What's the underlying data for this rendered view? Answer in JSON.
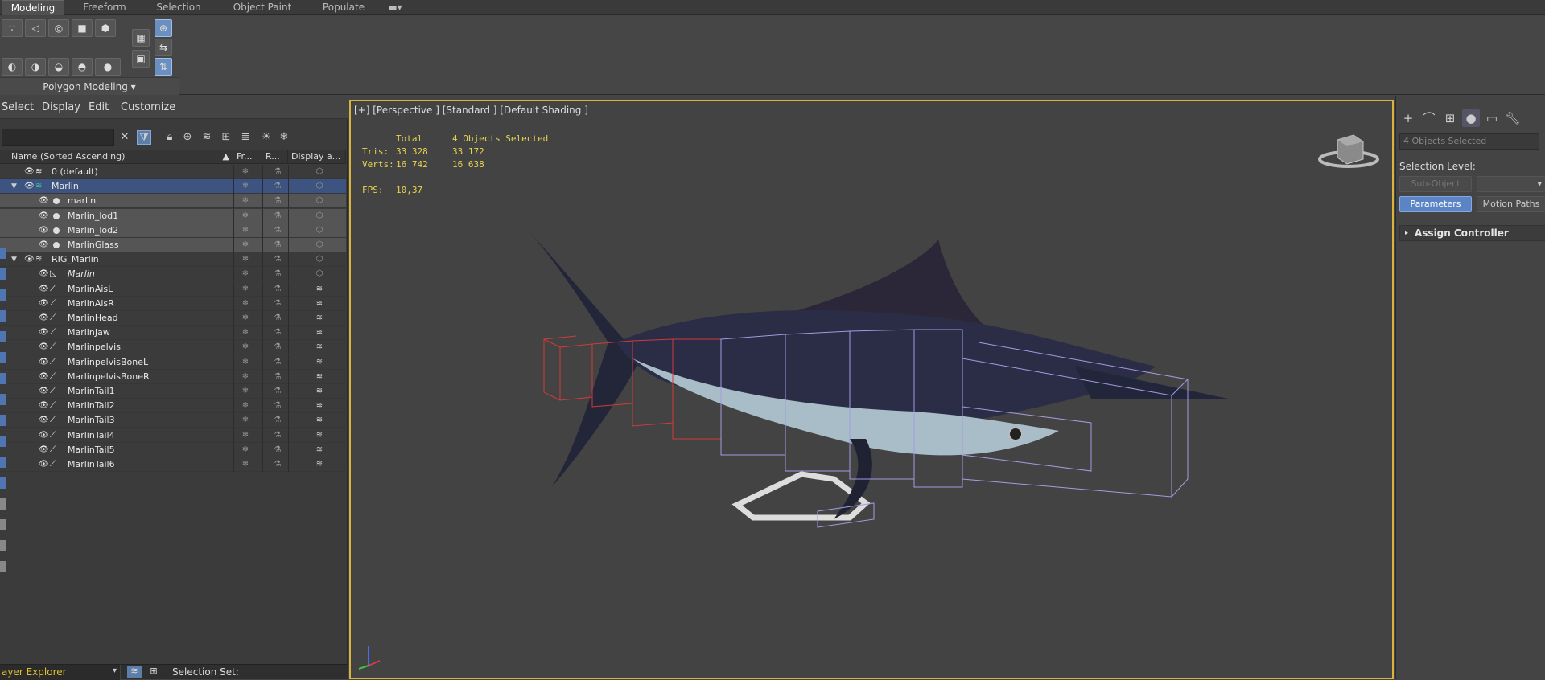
{
  "ribbon": {
    "tabs": [
      "Modeling",
      "Freeform",
      "Selection",
      "Object Paint",
      "Populate"
    ],
    "active_tab": "Modeling",
    "panel_label": "Polygon Modeling"
  },
  "explorer": {
    "menu": [
      "Select",
      "Display",
      "Edit",
      "Customize"
    ],
    "columns": {
      "name": "Name (Sorted Ascending)",
      "sort_marker": "▲",
      "frozen": "Fr...",
      "render": "R...",
      "display": "Display a..."
    },
    "rows": [
      {
        "label": "0 (default)",
        "indent": 0,
        "kind": "layer"
      },
      {
        "label": "Marlin",
        "indent": 0,
        "kind": "layer-open"
      },
      {
        "label": "marlin",
        "indent": 1,
        "kind": "object"
      },
      {
        "label": "Marlin_lod1",
        "indent": 1,
        "kind": "object"
      },
      {
        "label": "Marlin_lod2",
        "indent": 1,
        "kind": "object"
      },
      {
        "label": "MarlinGlass",
        "indent": 1,
        "kind": "object"
      },
      {
        "label": "RIG_Marlin",
        "indent": 0,
        "kind": "layer-open"
      },
      {
        "label": "Marlin",
        "indent": 1,
        "kind": "rig-root"
      },
      {
        "label": "MarlinAisL",
        "indent": 1,
        "kind": "bone"
      },
      {
        "label": "MarlinAisR",
        "indent": 1,
        "kind": "bone"
      },
      {
        "label": "MarlinHead",
        "indent": 1,
        "kind": "bone"
      },
      {
        "label": "MarlinJaw",
        "indent": 1,
        "kind": "bone"
      },
      {
        "label": "Marlinpelvis",
        "indent": 1,
        "kind": "bone"
      },
      {
        "label": "MarlinpelvisBoneL",
        "indent": 1,
        "kind": "bone"
      },
      {
        "label": "MarlinpelvisBoneR",
        "indent": 1,
        "kind": "bone"
      },
      {
        "label": "MarlinTail1",
        "indent": 1,
        "kind": "bone"
      },
      {
        "label": "MarlinTail2",
        "indent": 1,
        "kind": "bone"
      },
      {
        "label": "MarlinTail3",
        "indent": 1,
        "kind": "bone"
      },
      {
        "label": "MarlinTail4",
        "indent": 1,
        "kind": "bone"
      },
      {
        "label": "MarlinTail5",
        "indent": 1,
        "kind": "bone"
      },
      {
        "label": "MarlinTail6",
        "indent": 1,
        "kind": "bone"
      }
    ],
    "bottom": {
      "layer_explorer": "ayer Explorer",
      "selection_set": "Selection Set:"
    }
  },
  "viewport": {
    "label": "[+] [Perspective ] [Standard ] [Default Shading ]",
    "stats": {
      "total_header": "Total",
      "selected_header": "4 Objects Selected",
      "tris_label": "Tris:",
      "tris_total": "33 328",
      "tris_selected": "33 172",
      "verts_label": "Verts:",
      "verts_total": "16 742",
      "verts_selected": "16 638",
      "fps_label": "FPS:",
      "fps_value": "10,37"
    }
  },
  "command_panel": {
    "selection_field": "4 Objects Selected",
    "selection_level": "Selection Level:",
    "sub_object": "Sub-Object",
    "parameters": "Parameters",
    "motion_paths": "Motion Paths",
    "assign_controller": "Assign Controller"
  },
  "colors": {
    "viewport_border": "#d9b43c",
    "stats_text": "#e8d44d",
    "selection_blue": "#5b84c4"
  }
}
